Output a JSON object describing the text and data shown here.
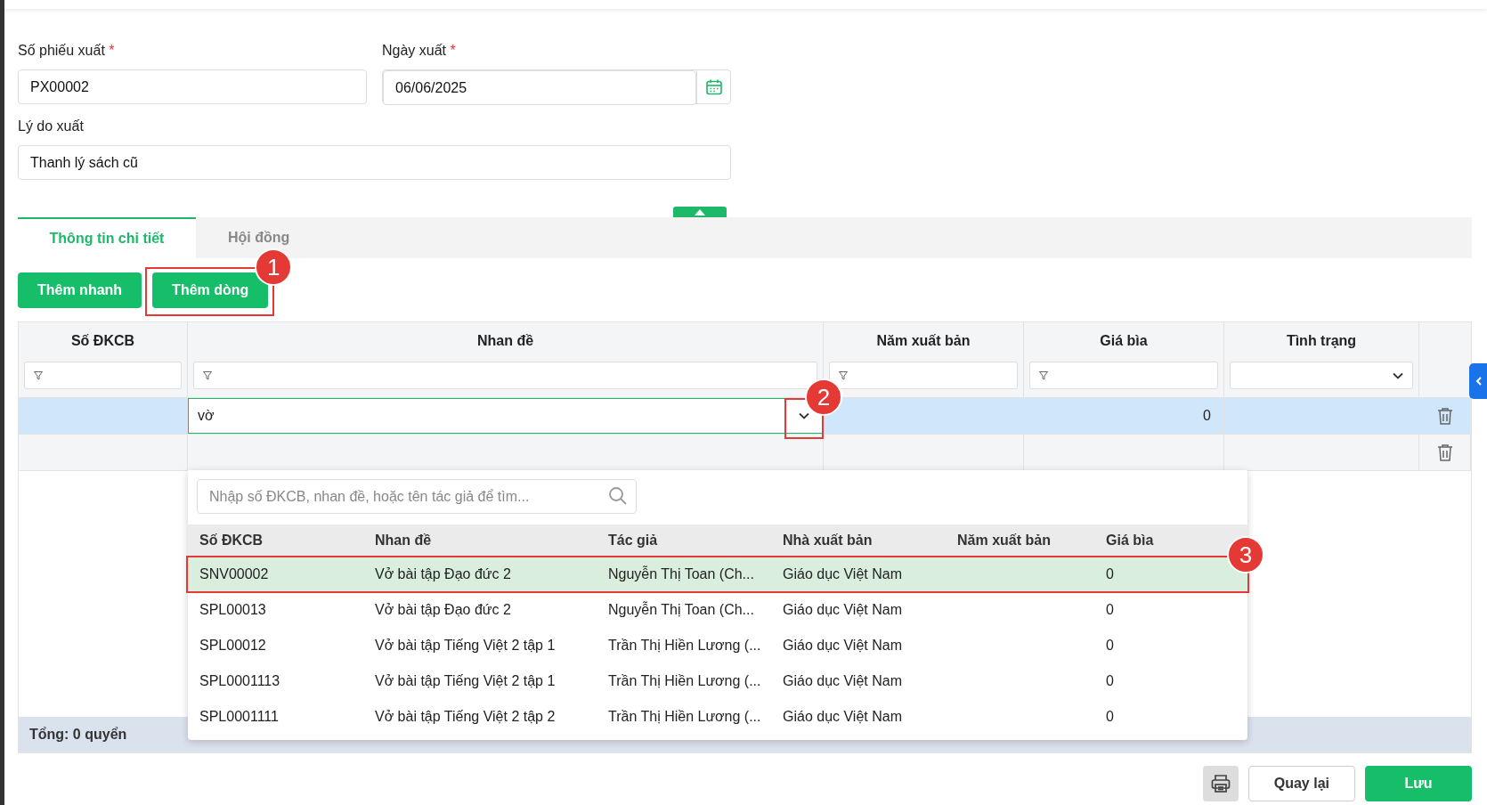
{
  "form": {
    "receipt_no": {
      "label": "Số phiếu xuất",
      "required_mark": "*",
      "value": "PX00002"
    },
    "export_date": {
      "label": "Ngày xuất",
      "required_mark": "*",
      "value": "06/06/2025"
    },
    "reason": {
      "label": "Lý do xuất",
      "value": "Thanh lý sách cũ"
    }
  },
  "tabs": [
    {
      "label": "Thông tin chi tiết",
      "selected": true
    },
    {
      "label": "Hội đồng",
      "selected": false
    }
  ],
  "toolbar_buttons": [
    {
      "label": "Thêm nhanh"
    },
    {
      "label": "Thêm dòng"
    }
  ],
  "table": {
    "columns": [
      {
        "label": "Số ĐKCB",
        "kind": "text"
      },
      {
        "label": "Nhan đề",
        "kind": "text"
      },
      {
        "label": "Năm xuất bản",
        "kind": "text"
      },
      {
        "label": "Giá bìa",
        "kind": "text"
      },
      {
        "label": "Tình trạng",
        "kind": "select"
      }
    ],
    "rows": [
      {
        "selected": true,
        "title_value": "vờ",
        "price": "0"
      },
      {
        "selected": false
      }
    ]
  },
  "dropdown": {
    "search_placeholder": "Nhập số ĐKCB, nhan đề, hoặc tên tác giả để tìm...",
    "columns": [
      "Số ĐKCB",
      "Nhan đề",
      "Tác giả",
      "Nhà xuất bản",
      "Năm xuất bản",
      "Giá bìa"
    ],
    "rows": [
      {
        "selected": true,
        "cells": [
          "SNV00002",
          "Vở bài tập Đạo đức 2",
          "Nguyễn Thị Toan (Ch...",
          "Giáo dục Việt Nam",
          "",
          "0"
        ]
      },
      {
        "selected": false,
        "cells": [
          "SPL00013",
          "Vở bài tập Đạo đức 2",
          "Nguyễn Thị Toan (Ch...",
          "Giáo dục Việt Nam",
          "",
          "0"
        ]
      },
      {
        "selected": false,
        "cells": [
          "SPL00012",
          "Vở bài tập Tiếng Việt 2 tập 1",
          "Trần Thị Hiền Lương (...",
          "Giáo dục Việt Nam",
          "",
          "0"
        ]
      },
      {
        "selected": false,
        "cells": [
          "SPL0001113",
          "Vở bài tập Tiếng Việt 2 tập 1",
          "Trần Thị Hiền Lương (...",
          "Giáo dục Việt Nam",
          "",
          "0"
        ]
      },
      {
        "selected": false,
        "cells": [
          "SPL0001111",
          "Vở bài tập Tiếng Việt 2 tập 2",
          "Trần Thị Hiền Lương (...",
          "Giáo dục Việt Nam",
          "",
          "0"
        ]
      }
    ]
  },
  "annotations": [
    "1",
    "2",
    "3"
  ],
  "footer": {
    "total": "Tổng: 0 quyển"
  },
  "actions": [
    {
      "kind": "print"
    },
    {
      "kind": "secondary",
      "label": "Quay lại"
    },
    {
      "kind": "primary",
      "label": "Lưu"
    }
  ]
}
